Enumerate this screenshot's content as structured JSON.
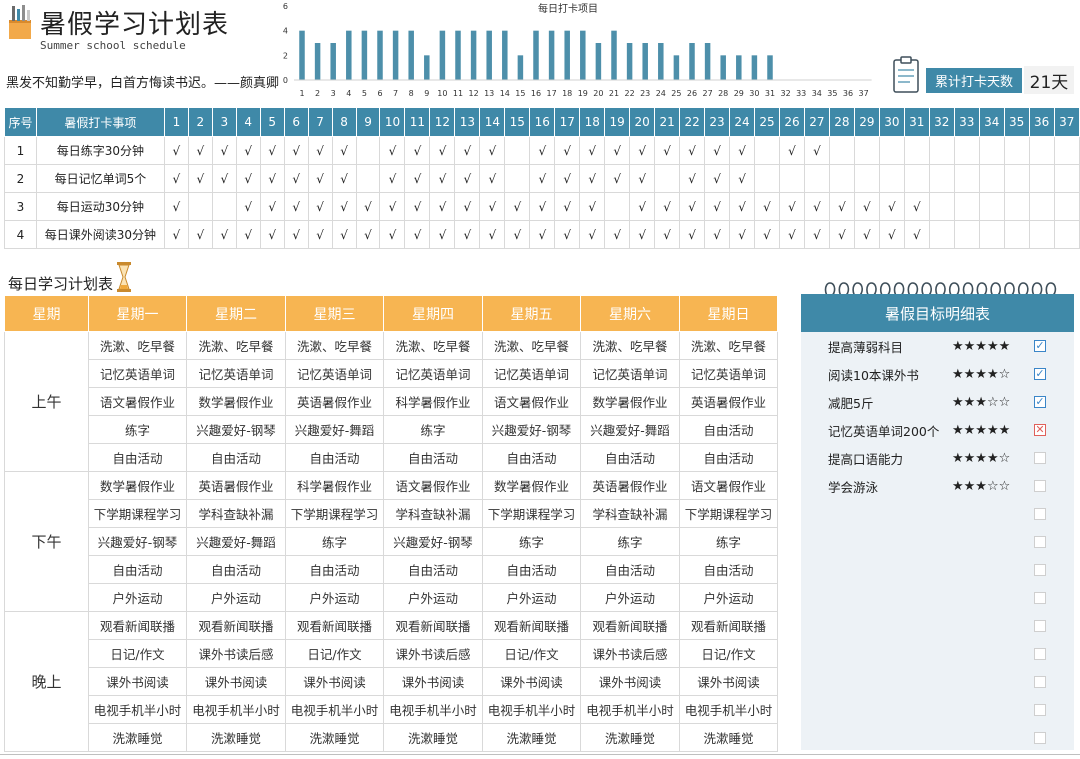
{
  "header": {
    "title": "暑假学习计划表",
    "subtitle": "Summer school schedule",
    "quote": "黑发不知勤学早，白首方悔读书迟。——颜真卿",
    "streak_label": "累计打卡天数",
    "streak_value": "21天"
  },
  "colors": {
    "accent": "#3f89a8",
    "orange": "#f7b552",
    "panel": "#edf2f6"
  },
  "chart_data": {
    "type": "bar",
    "title": "每日打卡项目",
    "ylim": [
      0,
      6
    ],
    "yticks": [
      0,
      2,
      4,
      6
    ],
    "categories": [
      "1",
      "2",
      "3",
      "4",
      "5",
      "6",
      "7",
      "8",
      "9",
      "10",
      "11",
      "12",
      "13",
      "14",
      "15",
      "16",
      "17",
      "18",
      "19",
      "20",
      "21",
      "22",
      "23",
      "24",
      "25",
      "26",
      "27",
      "28",
      "29",
      "30",
      "31",
      "32",
      "33",
      "34",
      "35",
      "36",
      "37"
    ],
    "values": [
      4,
      3,
      3,
      4,
      4,
      4,
      4,
      4,
      2,
      4,
      4,
      4,
      4,
      4,
      2,
      4,
      4,
      4,
      4,
      3,
      4,
      3,
      3,
      3,
      2,
      3,
      3,
      2,
      2,
      2,
      2,
      0,
      0,
      0,
      0,
      0,
      0
    ],
    "color": "#4d8faa"
  },
  "checkin": {
    "headers": {
      "index": "序号",
      "task": "暑假打卡事项"
    },
    "days": [
      "1",
      "2",
      "3",
      "4",
      "5",
      "6",
      "7",
      "8",
      "9",
      "10",
      "11",
      "12",
      "13",
      "14",
      "15",
      "16",
      "17",
      "18",
      "19",
      "20",
      "21",
      "22",
      "23",
      "24",
      "25",
      "26",
      "27",
      "28",
      "29",
      "30",
      "31",
      "32",
      "33",
      "34",
      "35",
      "36",
      "37"
    ],
    "rows": [
      {
        "index": "1",
        "task": "每日练字30分钟",
        "marks": [
          "√",
          "√",
          "√",
          "√",
          "√",
          "√",
          "√",
          "√",
          "",
          "√",
          "√",
          "√",
          "√",
          "√",
          "",
          "√",
          "√",
          "√",
          "√",
          "√",
          "√",
          "√",
          "√",
          "√",
          "",
          "√",
          "√",
          "",
          "",
          "",
          "",
          "",
          "",
          "",
          "",
          "",
          ""
        ]
      },
      {
        "index": "2",
        "task": "每日记忆单词5个",
        "marks": [
          "√",
          "√",
          "√",
          "√",
          "√",
          "√",
          "√",
          "√",
          "",
          "√",
          "√",
          "√",
          "√",
          "√",
          "",
          "√",
          "√",
          "√",
          "√",
          "√",
          "",
          "√",
          "√",
          "√",
          "",
          "",
          "",
          "",
          "",
          "",
          "",
          "",
          "",
          "",
          "",
          "",
          ""
        ]
      },
      {
        "index": "3",
        "task": "每日运动30分钟",
        "marks": [
          "√",
          "",
          "",
          "√",
          "√",
          "√",
          "√",
          "√",
          "√",
          "√",
          "√",
          "√",
          "√",
          "√",
          "√",
          "√",
          "√",
          "√",
          "",
          "√",
          "√",
          "√",
          "√",
          "√",
          "√",
          "√",
          "√",
          "√",
          "√",
          "√",
          "√",
          "",
          "",
          "",
          "",
          "",
          ""
        ]
      },
      {
        "index": "4",
        "task": "每日课外阅读30分钟",
        "marks": [
          "√",
          "√",
          "√",
          "√",
          "√",
          "√",
          "√",
          "√",
          "√",
          "√",
          "√",
          "√",
          "√",
          "√",
          "√",
          "√",
          "√",
          "√",
          "√",
          "√",
          "√",
          "√",
          "√",
          "√",
          "√",
          "√",
          "√",
          "√",
          "√",
          "√",
          "√",
          "",
          "",
          "",
          "",
          "",
          ""
        ]
      }
    ]
  },
  "daily_plan": {
    "title": "每日学习计划表",
    "headers": [
      "星期",
      "星期一",
      "星期二",
      "星期三",
      "星期四",
      "星期五",
      "星期六",
      "星期日"
    ],
    "periods": [
      {
        "name": "上午",
        "rows": [
          [
            "洗漱、吃早餐",
            "洗漱、吃早餐",
            "洗漱、吃早餐",
            "洗漱、吃早餐",
            "洗漱、吃早餐",
            "洗漱、吃早餐",
            "洗漱、吃早餐"
          ],
          [
            "记忆英语单词",
            "记忆英语单词",
            "记忆英语单词",
            "记忆英语单词",
            "记忆英语单词",
            "记忆英语单词",
            "记忆英语单词"
          ],
          [
            "语文暑假作业",
            "数学暑假作业",
            "英语暑假作业",
            "科学暑假作业",
            "语文暑假作业",
            "数学暑假作业",
            "英语暑假作业"
          ],
          [
            "练字",
            "兴趣爱好-钢琴",
            "兴趣爱好-舞蹈",
            "练字",
            "兴趣爱好-钢琴",
            "兴趣爱好-舞蹈",
            "自由活动"
          ],
          [
            "自由活动",
            "自由活动",
            "自由活动",
            "自由活动",
            "自由活动",
            "自由活动",
            "自由活动"
          ]
        ]
      },
      {
        "name": "下午",
        "rows": [
          [
            "数学暑假作业",
            "英语暑假作业",
            "科学暑假作业",
            "语文暑假作业",
            "数学暑假作业",
            "英语暑假作业",
            "语文暑假作业"
          ],
          [
            "下学期课程学习",
            "学科查缺补漏",
            "下学期课程学习",
            "学科查缺补漏",
            "下学期课程学习",
            "学科查缺补漏",
            "下学期课程学习"
          ],
          [
            "兴趣爱好-钢琴",
            "兴趣爱好-舞蹈",
            "练字",
            "兴趣爱好-钢琴",
            "练字",
            "练字",
            "练字"
          ],
          [
            "自由活动",
            "自由活动",
            "自由活动",
            "自由活动",
            "自由活动",
            "自由活动",
            "自由活动"
          ],
          [
            "户外运动",
            "户外运动",
            "户外运动",
            "户外运动",
            "户外运动",
            "户外运动",
            "户外运动"
          ]
        ]
      },
      {
        "name": "晚上",
        "rows": [
          [
            "观看新闻联播",
            "观看新闻联播",
            "观看新闻联播",
            "观看新闻联播",
            "观看新闻联播",
            "观看新闻联播",
            "观看新闻联播"
          ],
          [
            "日记/作文",
            "课外书读后感",
            "日记/作文",
            "课外书读后感",
            "日记/作文",
            "课外书读后感",
            "日记/作文"
          ],
          [
            "课外书阅读",
            "课外书阅读",
            "课外书阅读",
            "课外书阅读",
            "课外书阅读",
            "课外书阅读",
            "课外书阅读"
          ],
          [
            "电视手机半小时",
            "电视手机半小时",
            "电视手机半小时",
            "电视手机半小时",
            "电视手机半小时",
            "电视手机半小时",
            "电视手机半小时"
          ],
          [
            "洗漱睡觉",
            "洗漱睡觉",
            "洗漱睡觉",
            "洗漱睡觉",
            "洗漱睡觉",
            "洗漱睡觉",
            "洗漱睡觉"
          ]
        ]
      }
    ]
  },
  "goals": {
    "title": "暑假目标明细表",
    "items": [
      {
        "text": "提高薄弱科目",
        "stars": "★★★★★",
        "status": "done",
        "mark": "☑"
      },
      {
        "text": "阅读10本课外书",
        "stars": "★★★★☆",
        "status": "done",
        "mark": "☑"
      },
      {
        "text": "减肥5斤",
        "stars": "★★★☆☆",
        "status": "done",
        "mark": "☑"
      },
      {
        "text": "记忆英语单词200个",
        "stars": "★★★★★",
        "status": "fail",
        "mark": "☒"
      },
      {
        "text": "提高口语能力",
        "stars": "★★★★☆",
        "status": "empty",
        "mark": ""
      },
      {
        "text": "学会游泳",
        "stars": "★★★☆☆",
        "status": "empty",
        "mark": ""
      },
      {
        "text": "",
        "stars": "",
        "status": "empty",
        "mark": ""
      },
      {
        "text": "",
        "stars": "",
        "status": "empty",
        "mark": ""
      },
      {
        "text": "",
        "stars": "",
        "status": "empty",
        "mark": ""
      },
      {
        "text": "",
        "stars": "",
        "status": "empty",
        "mark": ""
      },
      {
        "text": "",
        "stars": "",
        "status": "empty",
        "mark": ""
      },
      {
        "text": "",
        "stars": "",
        "status": "empty",
        "mark": ""
      },
      {
        "text": "",
        "stars": "",
        "status": "empty",
        "mark": ""
      },
      {
        "text": "",
        "stars": "",
        "status": "empty",
        "mark": ""
      },
      {
        "text": "",
        "stars": "",
        "status": "empty",
        "mark": ""
      }
    ]
  }
}
